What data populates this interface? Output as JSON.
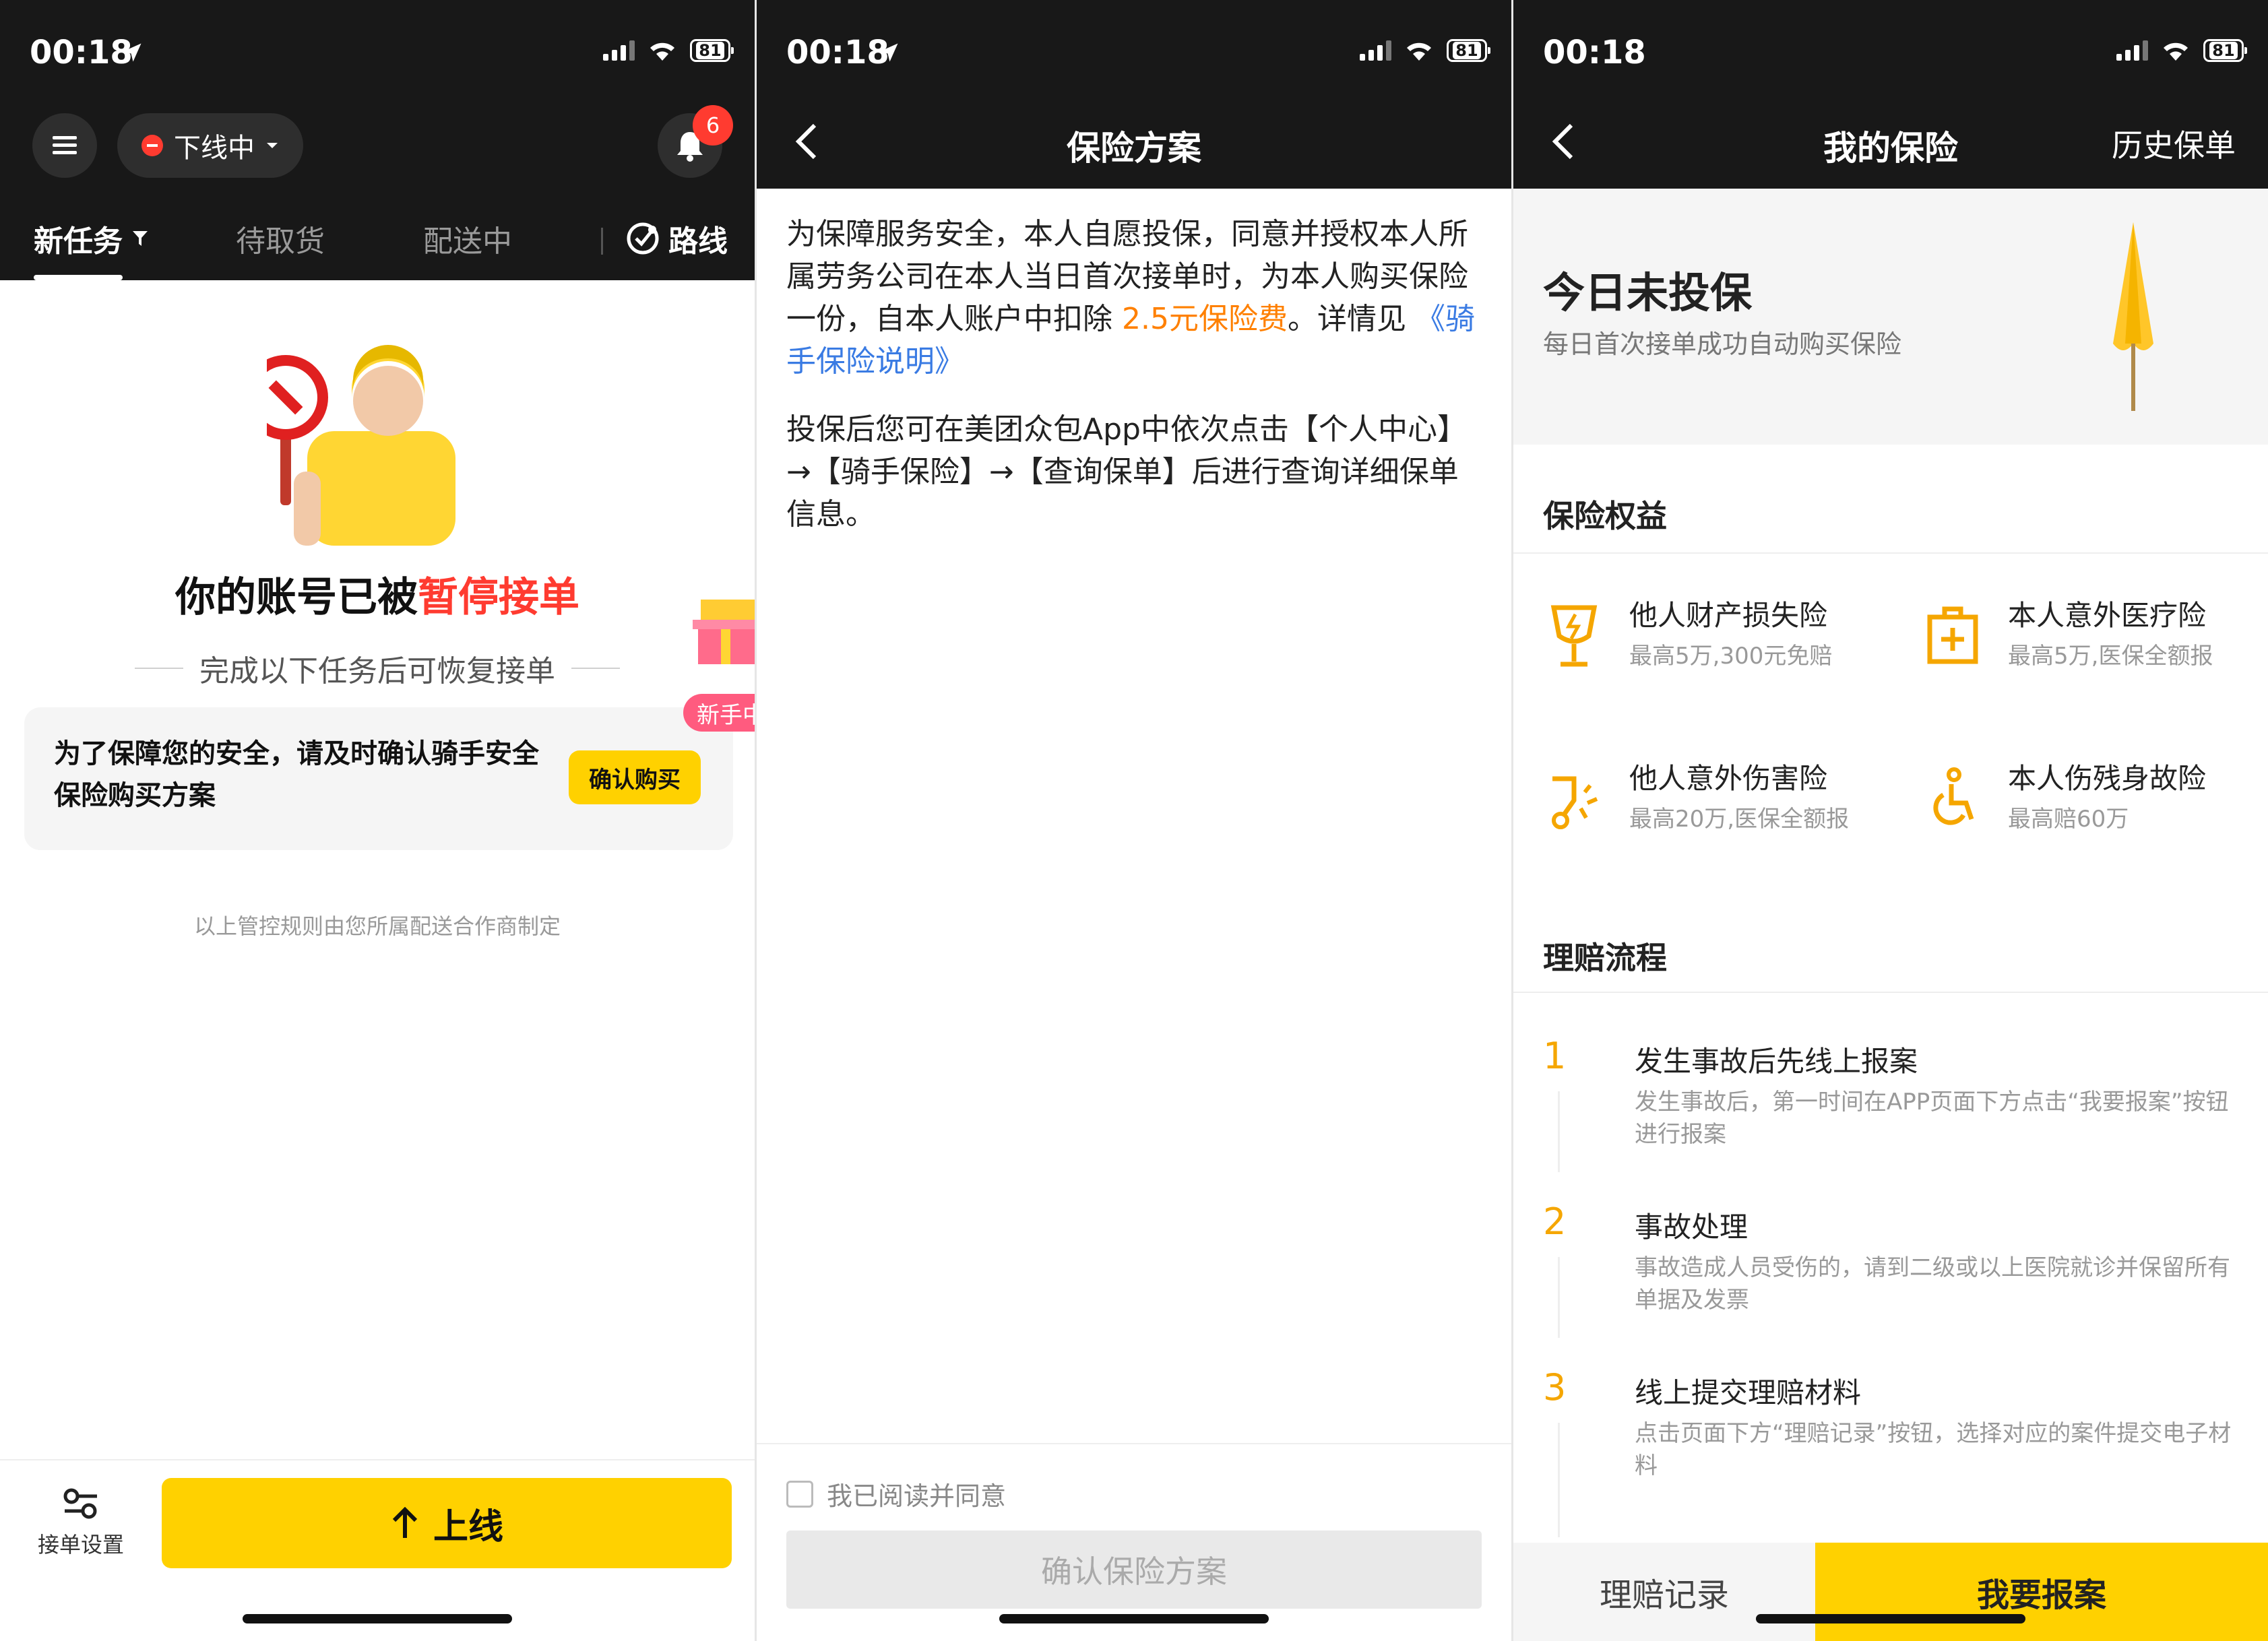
{
  "status_bar": {
    "time": "00:18",
    "battery": "81"
  },
  "screen1": {
    "status_pill": "下线中",
    "notification_count": "6",
    "tabs": [
      "新任务",
      "待取货",
      "配送中"
    ],
    "route_label": "路线",
    "pause_title_prefix": "你的账号已被",
    "pause_title_highlight": "暂停接单",
    "pause_subtitle": "完成以下任务后可恢复接单",
    "task_text": "为了保障您的安全，请及时确认骑手安全保险购买方案",
    "confirm_buy_label": "确认购买",
    "gift_label": "新手中",
    "rule_note": "以上管控规则由您所属配送合作商制定",
    "order_settings_label": "接单设置",
    "online_button_label": "上线"
  },
  "screen2": {
    "title": "保险方案",
    "paragraph1_before": "为保障服务安全，本人自愿投保，同意并授权本人所属劳务公司在本人当日首次接单时，为本人购买保险一份，自本人账户中扣除 ",
    "fee_text": "2.5元保险费",
    "paragraph1_after": "。详情见 ",
    "link_text": "《骑手保险说明》",
    "paragraph2": "投保后您可在美团众包App中依次点击【个人中心】→【骑手保险】→【查询保单】后进行查询详细保单信息。",
    "agree_label": "我已阅读并同意",
    "confirm_label": "确认保险方案"
  },
  "screen3": {
    "title": "我的保险",
    "history_label": "历史保单",
    "hero_title": "今日未投保",
    "hero_subtitle": "每日首次接单成功自动购买保险",
    "benefits_heading": "保险权益",
    "benefits": [
      {
        "title": "他人财产损失险",
        "desc": "最高5万,300元免赔"
      },
      {
        "title": "本人意外医疗险",
        "desc": "最高5万,医保全额报"
      },
      {
        "title": "他人意外伤害险",
        "desc": "最高20万,医保全额报"
      },
      {
        "title": "本人伤残身故险",
        "desc": "最高赔60万"
      }
    ],
    "claims_heading": "理赔流程",
    "steps": [
      {
        "num": "1",
        "title": "发生事故后先线上报案",
        "desc": "发生事故后，第一时间在APP页面下方点击“我要报案”按钮进行报案"
      },
      {
        "num": "2",
        "title": "事故处理",
        "desc": "事故造成人员受伤的，请到二级或以上医院就诊并保留所有单据及发票"
      },
      {
        "num": "3",
        "title": "线上提交理赔材料",
        "desc": "点击页面下方“理赔记录”按钮，选择对应的案件提交电子材料"
      }
    ],
    "claims_record_label": "理赔记录",
    "report_label": "我要报案"
  },
  "colors": {
    "accent_yellow": "#ffd100",
    "alert_red": "#ff3b30",
    "fee_orange": "#ff8000",
    "link_blue": "#3a7be3",
    "header_dark": "#181818"
  },
  "icons": [
    "location-arrow-icon",
    "signal-icon",
    "wifi-icon",
    "battery-icon",
    "menu-icon",
    "bell-icon",
    "filter-icon",
    "route-icon",
    "settings-icon",
    "arrow-up-icon",
    "back-icon",
    "umbrella-icon",
    "cup-icon",
    "medical-kit-icon",
    "injury-icon",
    "wheelchair-icon"
  ]
}
